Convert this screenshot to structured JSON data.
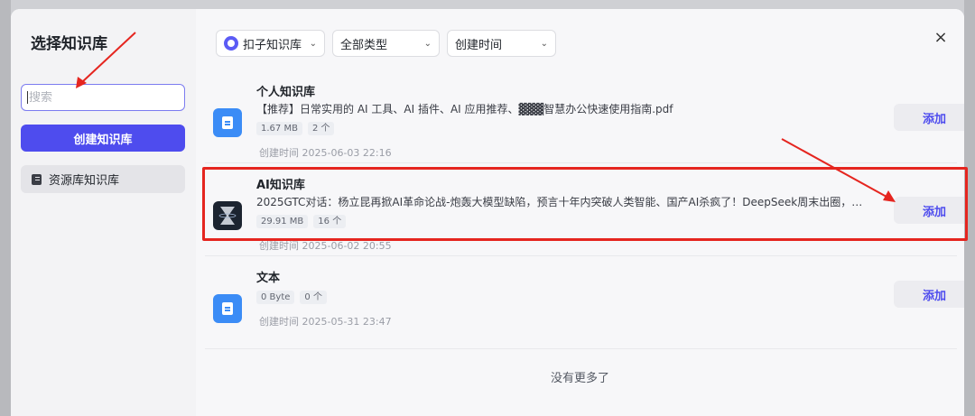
{
  "sidebar": {
    "title": "选择知识库",
    "search_placeholder": "搜索",
    "create_label": "创建知识库",
    "resource_label": "资源库知识库"
  },
  "filters": [
    {
      "label": "扣子知识库",
      "icon": "kouzi-logo-icon"
    },
    {
      "label": "全部类型"
    },
    {
      "label": "创建时间"
    }
  ],
  "close_icon": "×",
  "items": [
    {
      "title": "个人知识库",
      "desc": "【推荐】日常实用的 AI 工具、AI 插件、AI 应用推荐、▓▓▓智慧办公快速使用指南.pdf",
      "size": "1.67 MB",
      "count": "2 个",
      "time": "创建时间 2025-06-03 22:16",
      "add_label": "添加",
      "icon": "document-icon"
    },
    {
      "title": "AI知识库",
      "desc": "2025GTC对话：杨立昆再掀AI革命论战-炮轰大模型缺陷，预言十年内突破人类智能、国产AI杀疯了！DeepSeek周末出圈，把ChatG…",
      "size": "29.91 MB",
      "count": "16 个",
      "time": "创建时间 2025-06-02 20:55",
      "add_label": "添加",
      "icon": "hourglass-thumbnail-icon"
    },
    {
      "title": "文本",
      "desc": "",
      "size": "0 Byte",
      "count": "0 个",
      "time": "创建时间 2025-05-31 23:47",
      "add_label": "添加",
      "icon": "document-icon"
    }
  ],
  "footer": "没有更多了",
  "colors": {
    "accent": "#4e4cee",
    "annotation": "#e5251f",
    "doc_icon": "#3b8cf6"
  }
}
